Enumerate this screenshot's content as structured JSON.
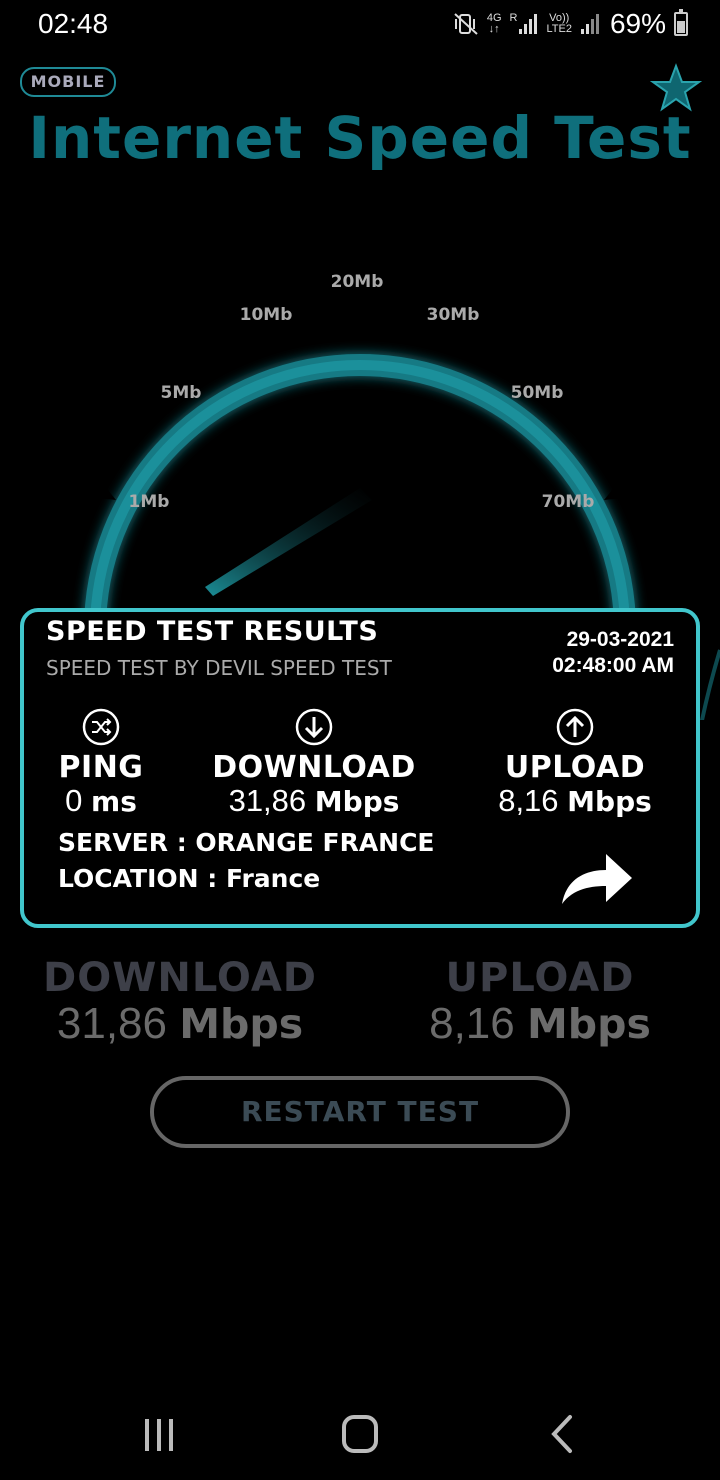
{
  "status_bar": {
    "time": "02:48",
    "network_type": "4G",
    "roaming": "R",
    "volte": "Vo))",
    "lte": "LTE2",
    "battery_percent": "69%",
    "battery_level": 0.69,
    "icons": [
      "mute-vibrate-icon",
      "signal-icon",
      "signal-icon",
      "battery-icon"
    ]
  },
  "header": {
    "badge": "MOBILE",
    "title": "Internet Speed Test",
    "star_icon": "star-icon"
  },
  "gauge": {
    "tick_labels": [
      "1Mb",
      "5Mb",
      "10Mb",
      "20Mb",
      "30Mb",
      "50Mb",
      "70Mb"
    ],
    "accent_color": "#2ab8c4"
  },
  "result_card": {
    "title": "SPEED TEST RESULTS",
    "subtitle": "SPEED TEST BY DEVIL SPEED TEST",
    "date": "29-03-2021",
    "time": "02:48:00 AM",
    "ping": {
      "label": "PING",
      "value": "0",
      "unit": "ms",
      "icon": "shuffle-icon"
    },
    "download": {
      "label": "DOWNLOAD",
      "value": "31,86",
      "unit": "Mbps",
      "icon": "arrow-down-icon"
    },
    "upload": {
      "label": "UPLOAD",
      "value": "8,16",
      "unit": "Mbps",
      "icon": "arrow-up-icon"
    },
    "server": "SERVER : ORANGE FRANCE",
    "location": "LOCATION : France",
    "share_icon": "share-icon",
    "border_color": "#41c6cc"
  },
  "readout": {
    "download_label": "DOWNLOAD",
    "download_value": "31,86",
    "download_unit": "Mbps",
    "upload_label": "UPLOAD",
    "upload_value": "8,16",
    "upload_unit": "Mbps"
  },
  "restart_label": "RESTART TEST",
  "nav_bar": {
    "icons": [
      "recents-icon",
      "home-icon",
      "back-icon"
    ]
  }
}
